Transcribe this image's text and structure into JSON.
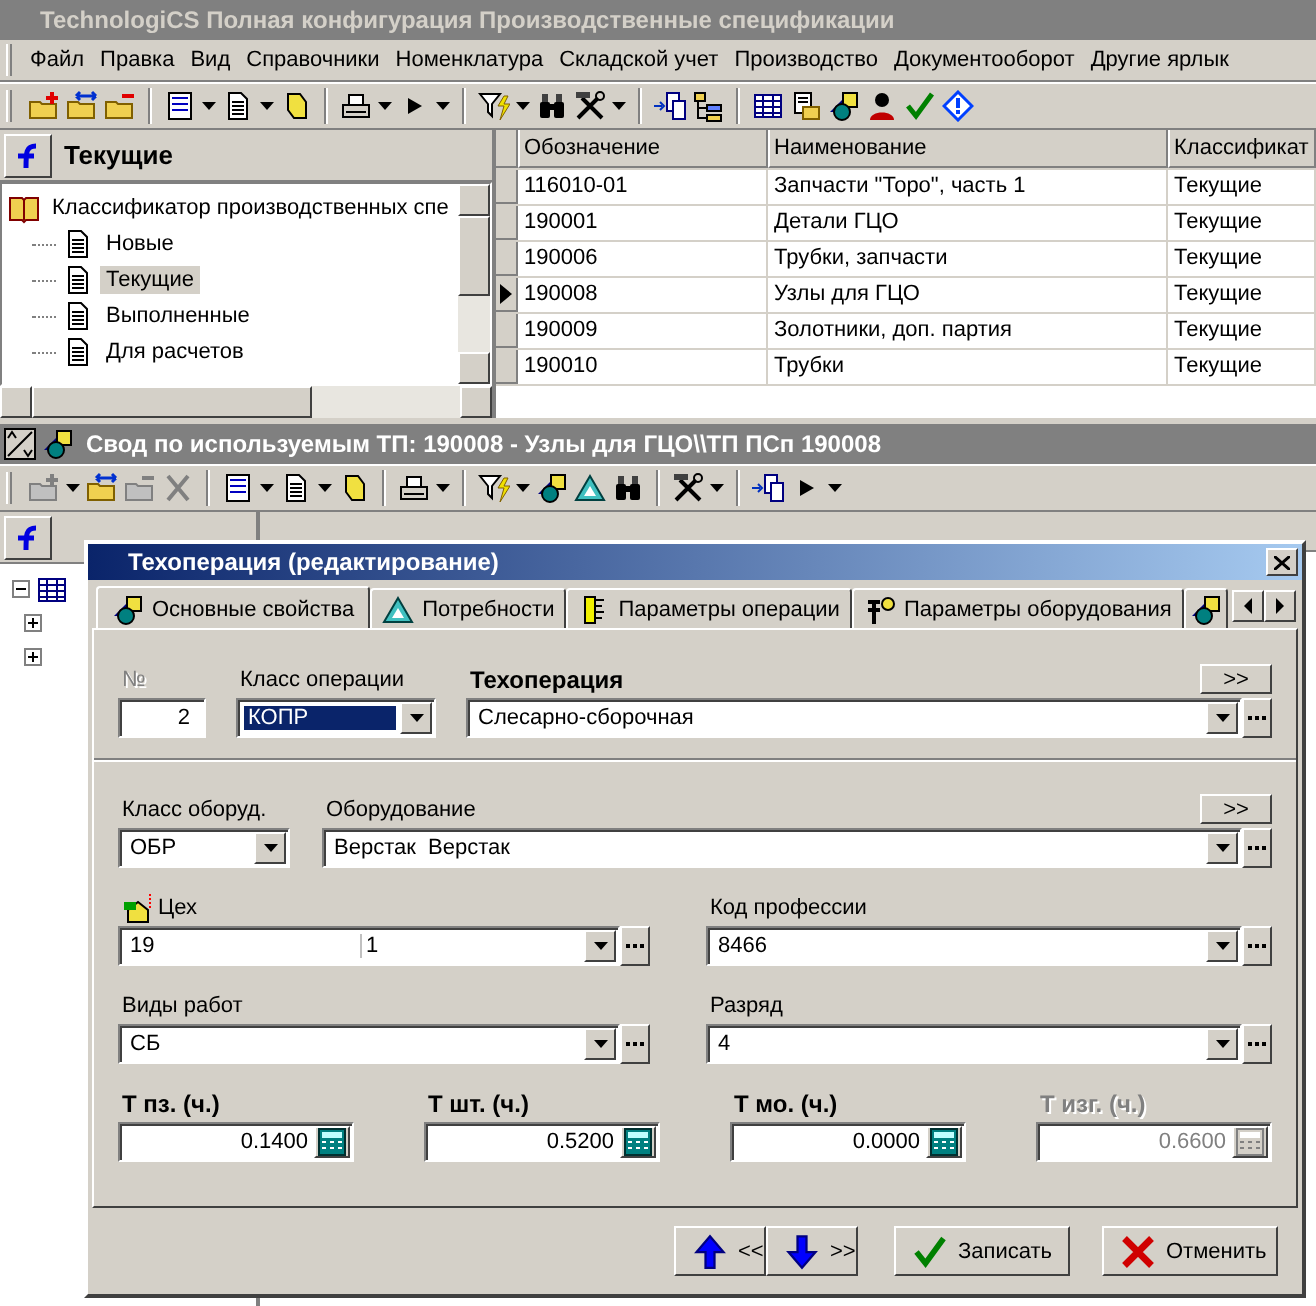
{
  "window": {
    "title": "TechnologiCS Полная конфигурация Производственные спецификации"
  },
  "menu": [
    "Файл",
    "Правка",
    "Вид",
    "Справочники",
    "Номенклатура",
    "Складской учет",
    "Производство",
    "Документооборот",
    "Другие ярлык"
  ],
  "classifier": {
    "title": "Текущие",
    "root": {
      "label": "Классификатор производственных спе",
      "children": [
        {
          "label": "Новые",
          "selected": false
        },
        {
          "label": "Текущие",
          "selected": true
        },
        {
          "label": "Выполненные",
          "selected": false
        },
        {
          "label": "Для расчетов",
          "selected": false
        }
      ]
    }
  },
  "specs_table": {
    "columns": [
      "Обозначение",
      "Наименование",
      "Классификат"
    ],
    "rows": [
      {
        "cells": [
          "116010-01",
          "Запчасти \"Торо\", часть 1",
          "Текущие"
        ],
        "selected": false
      },
      {
        "cells": [
          "190001",
          "Детали ГЦО",
          "Текущие"
        ],
        "selected": false
      },
      {
        "cells": [
          "190006",
          "Трубки, запчасти",
          "Текущие"
        ],
        "selected": false
      },
      {
        "cells": [
          "190008",
          "Узлы для ГЦО",
          "Текущие"
        ],
        "selected": true
      },
      {
        "cells": [
          "190009",
          "Золотники, доп. партия",
          "Текущие"
        ],
        "selected": false
      },
      {
        "cells": [
          "190010",
          "Трубки",
          "Текущие"
        ],
        "selected": false
      }
    ]
  },
  "child_window": {
    "title": "Свод по используемым ТП: 190008 - Узлы для ГЦО\\\\ТП ПСп 190008"
  },
  "dialog": {
    "title": "Техоперация (редактирование)",
    "tabs": [
      {
        "label": "Основные свойства",
        "selected": true
      },
      {
        "label": "Потребности",
        "selected": false
      },
      {
        "label": "Параметры операции",
        "selected": false
      },
      {
        "label": "Параметры оборудования",
        "selected": false
      }
    ],
    "rows": [
      {
        "divider_after": true,
        "fields": [
          {
            "kind": "number",
            "label": "№",
            "value": "2",
            "bold": false,
            "label_greyed": true,
            "disabled": false,
            "highlighted": false
          },
          {
            "kind": "combo",
            "label": "Класс операции",
            "value": "КОПР",
            "bold": false,
            "label_greyed": false,
            "disabled": false,
            "highlighted": true
          },
          {
            "kind": "lookup",
            "label": "Техоперация",
            "value": "Слесарно-сборочная",
            "more": ">>",
            "bold": true,
            "label_greyed": false,
            "disabled": false,
            "highlighted": false
          }
        ]
      },
      {
        "fields": [
          {
            "kind": "combo",
            "label": "Класс оборуд.",
            "value": "ОБР",
            "bold": false,
            "label_greyed": false,
            "disabled": false,
            "highlighted": false
          },
          {
            "kind": "lookup",
            "label": "Оборудование",
            "value": "Верстак  Верстак",
            "more": ">>",
            "bold": false,
            "label_greyed": false,
            "disabled": false,
            "highlighted": false
          }
        ]
      },
      {
        "fields": [
          {
            "kind": "split_lookup",
            "label": "Цех",
            "values": [
              "19",
              "1"
            ],
            "bold": false,
            "label_greyed": false,
            "disabled": false,
            "highlighted": false
          },
          {
            "kind": "lookup",
            "label": "Код профессии",
            "value": "8466",
            "bold": false,
            "label_greyed": false,
            "disabled": false,
            "highlighted": false
          }
        ]
      },
      {
        "fields": [
          {
            "kind": "lookup",
            "label": "Виды работ",
            "value": "СБ",
            "bold": false,
            "label_greyed": false,
            "disabled": false,
            "highlighted": false
          },
          {
            "kind": "lookup",
            "label": "Разряд",
            "value": "4",
            "bold": false,
            "label_greyed": false,
            "disabled": false,
            "highlighted": false
          }
        ]
      },
      {
        "fields": [
          {
            "kind": "calc",
            "label": "Т пз. (ч.)",
            "value": "0.1400",
            "bold": true,
            "label_greyed": false,
            "disabled": false,
            "highlighted": false
          },
          {
            "kind": "calc",
            "label": "Т шт. (ч.)",
            "value": "0.5200",
            "bold": true,
            "label_greyed": false,
            "disabled": false,
            "highlighted": false
          },
          {
            "kind": "calc",
            "label": "Т мо. (ч.)",
            "value": "0.0000",
            "bold": true,
            "label_greyed": false,
            "disabled": false,
            "highlighted": false
          },
          {
            "kind": "calc",
            "label": "Т изг. (ч.)",
            "value": "0.6600",
            "bold": true,
            "label_greyed": false,
            "disabled": true,
            "highlighted": false
          }
        ]
      }
    ],
    "buttons": [
      {
        "kind": "prev",
        "label": "<<"
      },
      {
        "kind": "next",
        "label": ">>"
      },
      {
        "kind": "save",
        "label": "Записать"
      },
      {
        "kind": "cancel",
        "label": "Отменить"
      }
    ]
  }
}
